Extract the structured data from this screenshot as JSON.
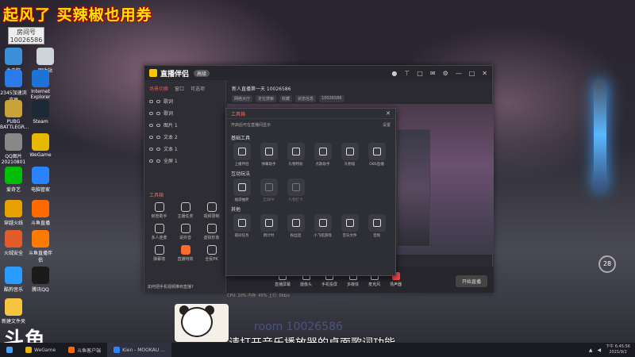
{
  "overlay": {
    "title": "起风了 买辣椒也用券",
    "room_label": "房间号",
    "room_number": "10026586"
  },
  "desktop_icons": [
    {
      "label": "此电脑",
      "color": "#3a8fd8"
    },
    {
      "label": "回收站",
      "color": "#cfd4da"
    },
    {
      "label": "2345加速浏览器",
      "color": "#2a7ae8"
    },
    {
      "label": "Internet Explorer",
      "color": "#1e74d6"
    },
    {
      "label": "PUBG BATTLEGR...",
      "color": "#c9a23a"
    },
    {
      "label": "Steam",
      "color": "#1b2838"
    },
    {
      "label": "QQ图片20210801",
      "color": "#888888"
    },
    {
      "label": "WeGame",
      "color": "#e6b800"
    },
    {
      "label": "爱奇艺",
      "color": "#00be06"
    },
    {
      "label": "电脑管家",
      "color": "#2a84ff"
    },
    {
      "label": "穿越火线",
      "color": "#e6a100"
    },
    {
      "label": "斗鱼直播",
      "color": "#ff6a00"
    },
    {
      "label": "火绒安全",
      "color": "#e45b2a"
    },
    {
      "label": "斗鱼直播伴侣",
      "color": "#ff7a00"
    },
    {
      "label": "酷狗音乐",
      "color": "#2a9cff"
    },
    {
      "label": "腾讯QQ",
      "color": "#1a1a1a"
    },
    {
      "label": "新建文件夹",
      "color": "#f5c542"
    }
  ],
  "app": {
    "logo": "直播伴侣",
    "version_tag": "高级",
    "top_icons": [
      "avatar-icon",
      "shirt-icon",
      "gift-icon",
      "mail-icon",
      "settings-icon",
      "minimize-icon",
      "maximize-icon",
      "close-icon"
    ],
    "tabs": [
      "场景切换",
      "窗口",
      "可选项"
    ],
    "layers": [
      "歌词",
      "歌词",
      "图片 1",
      "文本 2",
      "文本 1",
      "全屏 1"
    ],
    "tools_title": "工具箱",
    "tools": [
      "房管助手",
      "主播任务",
      "视频录制",
      "多人连麦",
      "说抖音",
      "虚拟形象",
      "弹幕墙",
      "直播特效",
      "全民PK"
    ],
    "bottom_hint": "如何把手机视频推到直播?",
    "room_title": "新人直播第一天 10026586",
    "room_meta": [
      "网络大厅",
      "定位搜索",
      "收藏",
      "状态信息",
      "10026586"
    ],
    "toolbar": [
      "直播屏幕",
      "摄像头",
      "手机投屏",
      "多媒体",
      "麦克风",
      "扬声器"
    ],
    "golive": "开始直播",
    "status": "CPU: 20%   内存: 45%   上行: 0kb/s"
  },
  "dialog": {
    "title": "工具箱",
    "subtitle": "开启后可在直播间显示",
    "setting": "设置",
    "sections": [
      {
        "name": "基础工具",
        "items": [
          "上播伴侣",
          "弹幕助手",
          "礼物特效",
          "点歌助手",
          "礼物墙",
          "OBS直播"
        ]
      },
      {
        "name": "互动玩法",
        "items": [
          "福袋抽奖",
          "互动PK",
          "礼物打卡"
        ]
      },
      {
        "name": "其他",
        "items": [
          "夜间任务",
          "倒计时",
          "粉丝团",
          "小飞船游戏",
          "音乐文件",
          "音频"
        ]
      }
    ]
  },
  "bubble": {
    "value": "28"
  },
  "subtitle": "请打开音乐播放器的桌面歌词功能",
  "douyu": "斗鱼",
  "watermark": "room 10026586",
  "taskbar": {
    "items": [
      "WeGame",
      "斗鱼客户端",
      "Kien - MOOKAU ..."
    ],
    "time": "下午 6:45:56",
    "date": "2021/9/2"
  }
}
